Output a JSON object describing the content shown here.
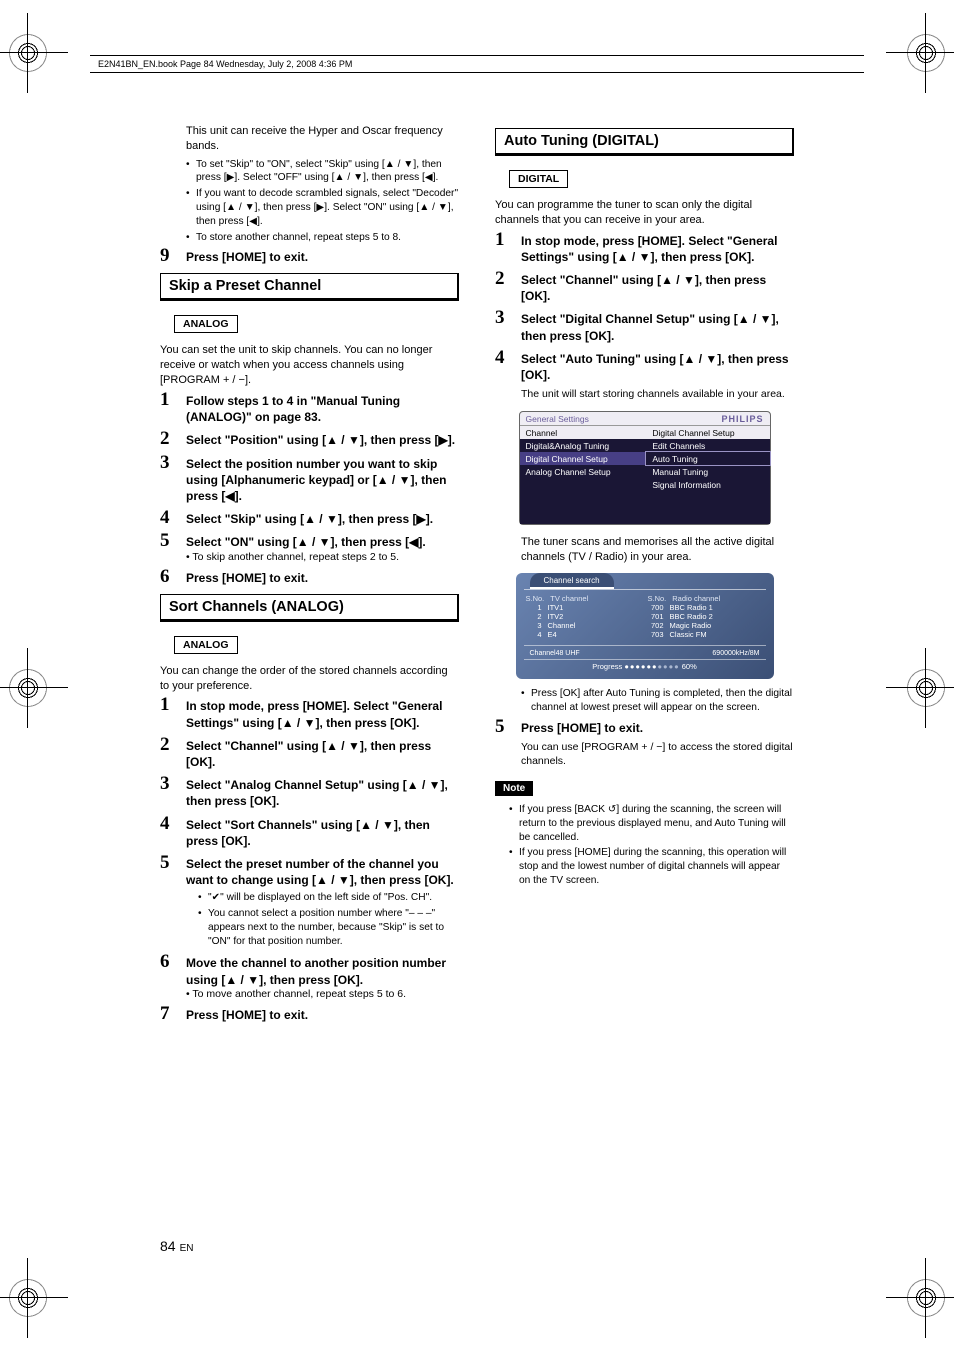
{
  "runningHead": "E2N41BN_EN.book  Page 84  Wednesday, July 2, 2008  4:36 PM",
  "pageNumber": "84",
  "pageNumberLang": "EN",
  "left": {
    "introPara": "This unit can receive the Hyper and Oscar frequency bands.",
    "introBullets": [
      "To set \"Skip\" to \"ON\", select \"Skip\" using [▲ / ▼], then press [▶]. Select \"OFF\" using [▲ / ▼], then press [◀].",
      "If you want to decode scrambled signals, select \"Decoder\" using [▲ / ▼], then press [▶]. Select \"ON\" using [▲ / ▼], then press [◀].",
      "To store another channel, repeat steps 5 to 8."
    ],
    "step9": {
      "num": "9",
      "text": "Press [HOME] to exit."
    },
    "skipHead": "Skip a Preset Channel",
    "analogBadge": "ANALOG",
    "skipIntro": "You can set the unit to skip channels. You can no longer receive or watch when you access channels using [PROGRAM + / −].",
    "skipSteps": [
      {
        "num": "1",
        "text": "Follow steps 1 to 4 in \"Manual Tuning (ANALOG)\" on page 83."
      },
      {
        "num": "2",
        "text": "Select \"Position\" using [▲ / ▼], then press [▶]."
      },
      {
        "num": "3",
        "text": "Select the position number you want to skip using [Alphanumeric keypad] or [▲ / ▼], then press [◀]."
      },
      {
        "num": "4",
        "text": "Select \"Skip\" using [▲ / ▼], then press [▶]."
      },
      {
        "num": "5",
        "text": "Select \"ON\" using [▲ / ▼], then press [◀].",
        "sub": "• To skip another channel, repeat steps 2 to 5."
      },
      {
        "num": "6",
        "text": "Press [HOME] to exit."
      }
    ],
    "sortHead": "Sort Channels (ANALOG)",
    "sortIntro": "You can change the order of the stored channels according to your preference.",
    "sortSteps": [
      {
        "num": "1",
        "text": "In stop mode, press [HOME]. Select \"General Settings\" using [▲ / ▼], then press [OK]."
      },
      {
        "num": "2",
        "text": "Select \"Channel\" using [▲ / ▼], then press [OK]."
      },
      {
        "num": "3",
        "text": "Select \"Analog Channel Setup\" using [▲ / ▼], then press [OK]."
      },
      {
        "num": "4",
        "text": "Select \"Sort Channels\" using [▲ / ▼], then press [OK]."
      },
      {
        "num": "5",
        "text": "Select the preset number of the channel you want to change using [▲ / ▼], then press [OK].",
        "subBullets": [
          "\"✔\" will be displayed on the left side of \"Pos. CH\".",
          "You cannot select a position number where \"– – –\" appears next to the number, because \"Skip\" is set to \"ON\" for that position number."
        ]
      },
      {
        "num": "6",
        "text": "Move the channel to another position number using [▲ / ▼], then press [OK].",
        "sub": "• To move another channel, repeat steps 5 to 6."
      },
      {
        "num": "7",
        "text": "Press [HOME] to exit."
      }
    ]
  },
  "right": {
    "autoHead": "Auto Tuning (DIGITAL)",
    "digitalBadge": "DIGITAL",
    "autoIntro": "You can programme the tuner to scan only the digital channels that you can receive in your area.",
    "autoSteps": [
      {
        "num": "1",
        "text": "In stop mode, press [HOME]. Select \"General Settings\" using [▲ / ▼], then press [OK]."
      },
      {
        "num": "2",
        "text": "Select \"Channel\" using [▲ / ▼], then press [OK]."
      },
      {
        "num": "3",
        "text": "Select \"Digital Channel Setup\" using [▲ / ▼], then press [OK]."
      },
      {
        "num": "4",
        "text": "Select \"Auto Tuning\" using [▲ / ▼], then press [OK].",
        "subPara": "The unit will start storing channels available in your area."
      }
    ],
    "menu": {
      "gsLabel": "General Settings",
      "brand": "PHILIPS",
      "channelLabel": "Channel",
      "rightTitle": "Digital Channel Setup",
      "leftItems": [
        "Digital&Analog Tuning",
        "Digital Channel Setup",
        "Analog Channel Setup"
      ],
      "rightItems": [
        "Edit Channels",
        "Auto Tuning",
        "Manual Tuning",
        "Signal Information"
      ]
    },
    "afterMenuPara": "The tuner scans and memorises all the active digital channels (TV / Radio) in your area.",
    "scan": {
      "tab": "Channel search",
      "tvHead1": "S.No.",
      "tvHead2": "TV channel",
      "radHead1": "S.No.",
      "radHead2": "Radio channel",
      "tv": [
        {
          "n": "1",
          "name": "ITV1"
        },
        {
          "n": "2",
          "name": "ITV2"
        },
        {
          "n": "3",
          "name": "Channel"
        },
        {
          "n": "4",
          "name": "E4"
        }
      ],
      "radio": [
        {
          "n": "700",
          "name": "BBC Radio 1"
        },
        {
          "n": "701",
          "name": "BBC Radio 2"
        },
        {
          "n": "702",
          "name": "Magic Radio"
        },
        {
          "n": "703",
          "name": "Classic FM"
        }
      ],
      "footL": "Channel48 UHF",
      "footR": "690000kHz/8M",
      "progressLabel": "Progress",
      "progressPct": "60%",
      "dotsOn": "●●●●●●",
      "dotsOff": "●●●●"
    },
    "afterScanBullet": "Press [OK] after Auto Tuning is completed, then the digital channel at lowest preset will appear on the screen.",
    "step5": {
      "num": "5",
      "text": "Press [HOME] to exit.",
      "subPara": "You can use [PROGRAM + / −] to access the stored digital channels."
    },
    "noteBadge": "Note",
    "noteBullets": [
      "If you press [BACK ↺] during the scanning, the screen will return to the previous displayed menu, and Auto Tuning will be cancelled.",
      "If you press [HOME] during the scanning, this operation will stop and the lowest number of digital channels will appear on the TV screen."
    ]
  }
}
